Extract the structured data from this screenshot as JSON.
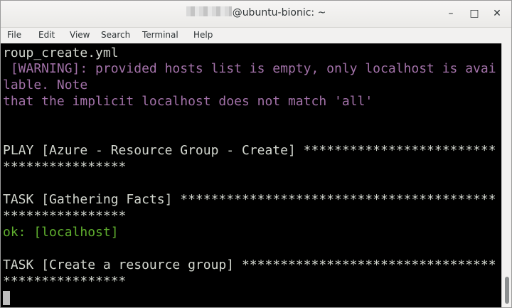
{
  "window": {
    "title": "@ubuntu-bionic: ~",
    "controls": {
      "minimize": "–",
      "maximize": "□",
      "close": "✕"
    }
  },
  "menubar": {
    "items": [
      "File",
      "Edit",
      "View",
      "Search",
      "Terminal",
      "Help"
    ]
  },
  "terminal": {
    "lines": [
      {
        "text": "roup_create.yml",
        "color": "default"
      },
      {
        "text": " [WARNING]: provided hosts list is empty, only localhost is avai",
        "color": "warning"
      },
      {
        "text": "lable. Note",
        "color": "warning"
      },
      {
        "text": "that the implicit localhost does not match 'all'",
        "color": "warning"
      },
      {
        "text": "",
        "color": "default"
      },
      {
        "text": "",
        "color": "default"
      },
      {
        "text": "PLAY [Azure - Resource Group - Create] *************************",
        "color": "default"
      },
      {
        "text": "****************",
        "color": "default"
      },
      {
        "text": "",
        "color": "default"
      },
      {
        "text": "TASK [Gathering Facts] *****************************************",
        "color": "default"
      },
      {
        "text": "****************",
        "color": "default"
      },
      {
        "text": "ok: [localhost]",
        "color": "ok"
      },
      {
        "text": "",
        "color": "default"
      },
      {
        "text": "TASK [Create a resource group] *********************************",
        "color": "default"
      },
      {
        "text": "****************",
        "color": "default"
      }
    ],
    "colors": {
      "default": "#d3d7cf",
      "warning": "#a271a8",
      "ok": "#5fae2e",
      "background": "#000000"
    }
  }
}
